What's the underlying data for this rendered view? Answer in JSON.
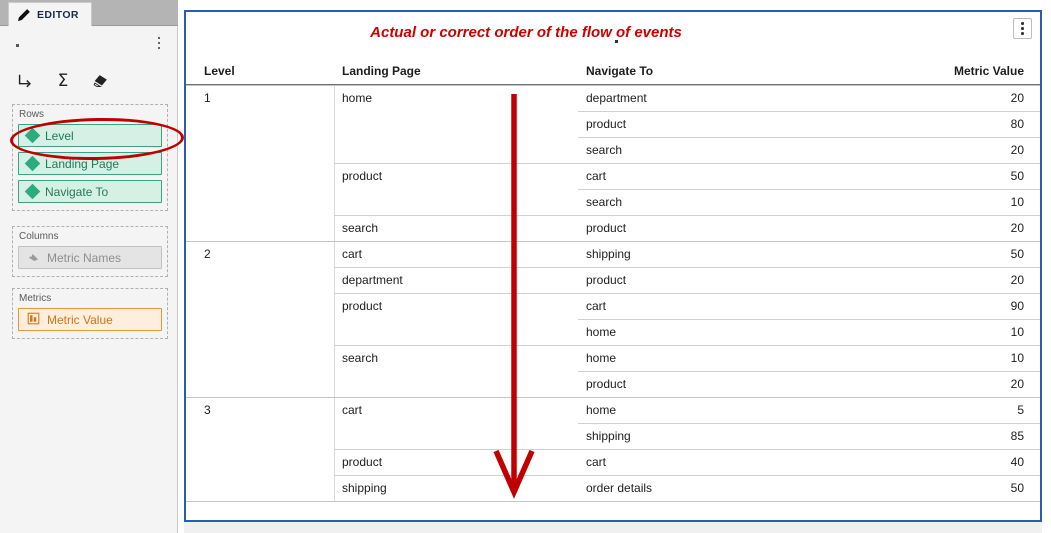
{
  "editor": {
    "tab_label": "EDITOR",
    "pencil_icon": "pencil-icon",
    "kebab_icon": "more-options-icon",
    "toolbar": [
      {
        "name": "drill-down-icon",
        "label": "└→"
      },
      {
        "name": "summation-icon",
        "label": "Σ"
      },
      {
        "name": "eraser-icon",
        "label": "eraser"
      }
    ],
    "shelves": [
      {
        "title": "Rows",
        "items": [
          {
            "label": "Level",
            "icon": "dimension-diamond-icon",
            "style": "dimension"
          },
          {
            "label": "Landing Page",
            "icon": "dimension-diamond-icon",
            "style": "dimension"
          },
          {
            "label": "Navigate To",
            "icon": "dimension-diamond-icon",
            "style": "dimension"
          }
        ]
      },
      {
        "title": "Columns",
        "items": [
          {
            "label": "Metric Names",
            "icon": "metric-names-tag-icon",
            "style": "disabled"
          }
        ]
      },
      {
        "title": "Metrics",
        "items": [
          {
            "label": "Metric Value",
            "icon": "metric-bars-icon",
            "style": "metric"
          }
        ]
      }
    ]
  },
  "report": {
    "title": "Actual or correct order of the flow of events",
    "title_color": "#cc0000",
    "panel_border_color": "#2a5db0",
    "kebab_icon": "report-more-options-icon",
    "annotation": {
      "arrow_name": "flow-direction-arrow",
      "arrow_color": "#c00000",
      "highlight_name": "level-field-highlight-ellipse",
      "highlight_color": "#c00000"
    },
    "columns": [
      "Level",
      "Landing Page",
      "Navigate To",
      "Metric Value"
    ],
    "rows": [
      {
        "level": "1",
        "landing": "home",
        "nav": "department",
        "value": "20",
        "rule": "full"
      },
      {
        "level": "",
        "landing": "",
        "nav": "product",
        "value": "80",
        "rule": "right"
      },
      {
        "level": "",
        "landing": "",
        "nav": "search",
        "value": "20",
        "rule": "right"
      },
      {
        "level": "",
        "landing": "product",
        "nav": "cart",
        "value": "50",
        "rule": "mid"
      },
      {
        "level": "",
        "landing": "",
        "nav": "search",
        "value": "10",
        "rule": "right"
      },
      {
        "level": "",
        "landing": "search",
        "nav": "product",
        "value": "20",
        "rule": "mid"
      },
      {
        "level": "2",
        "landing": "cart",
        "nav": "shipping",
        "value": "50",
        "rule": "full"
      },
      {
        "level": "",
        "landing": "department",
        "nav": "product",
        "value": "20",
        "rule": "mid"
      },
      {
        "level": "",
        "landing": "product",
        "nav": "cart",
        "value": "90",
        "rule": "mid"
      },
      {
        "level": "",
        "landing": "",
        "nav": "home",
        "value": "10",
        "rule": "right"
      },
      {
        "level": "",
        "landing": "search",
        "nav": "home",
        "value": "10",
        "rule": "mid"
      },
      {
        "level": "",
        "landing": "",
        "nav": "product",
        "value": "20",
        "rule": "right"
      },
      {
        "level": "3",
        "landing": "cart",
        "nav": "home",
        "value": "5",
        "rule": "full"
      },
      {
        "level": "",
        "landing": "",
        "nav": "shipping",
        "value": "85",
        "rule": "right"
      },
      {
        "level": "",
        "landing": "product",
        "nav": "cart",
        "value": "40",
        "rule": "mid"
      },
      {
        "level": "",
        "landing": "shipping",
        "nav": "order details",
        "value": "50",
        "rule": "mid"
      }
    ]
  }
}
